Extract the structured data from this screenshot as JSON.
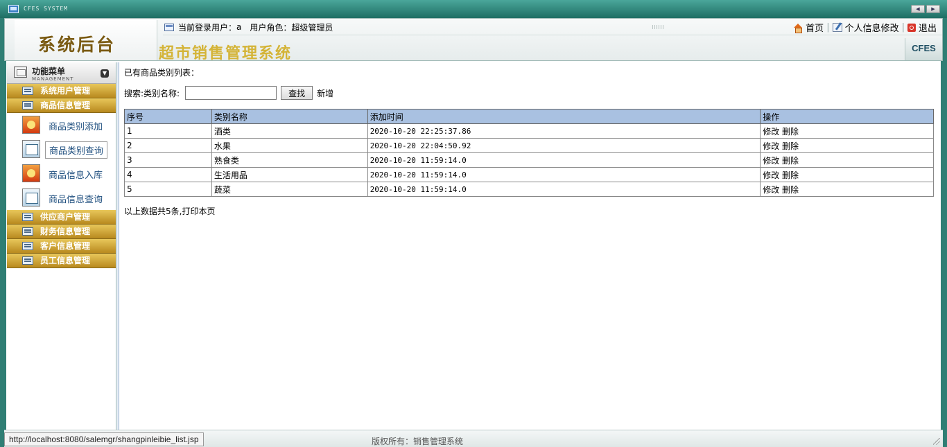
{
  "window": {
    "system_name": "CFES SYSTEM"
  },
  "header": {
    "back_title": "系统后台",
    "user_label": "当前登录用户：",
    "user_name": "a",
    "role_label": "用户角色：",
    "role_name": "超级管理员",
    "links": {
      "home": "首页",
      "profile": "个人信息修改",
      "logout": "退出"
    },
    "system_title": "超市销售管理系统",
    "brand": "CFES"
  },
  "sidebar": {
    "title": "功能菜单",
    "subtitle": "MANAGEMENT",
    "groups": [
      {
        "label": "系统用户管理"
      },
      {
        "label": "商品信息管理",
        "items": [
          {
            "label": "商品类别添加",
            "icon": "product-add-icon"
          },
          {
            "label": "商品类别查询",
            "icon": "product-query-icon",
            "active": true
          },
          {
            "label": "商品信息入库",
            "icon": "stock-in-icon"
          },
          {
            "label": "商品信息查询",
            "icon": "product-info-query-icon"
          }
        ]
      },
      {
        "label": "供应商户管理"
      },
      {
        "label": "财务信息管理"
      },
      {
        "label": "客户信息管理"
      },
      {
        "label": "员工信息管理"
      }
    ]
  },
  "main": {
    "heading": "已有商品类别列表：",
    "search": {
      "label": "搜索:类别名称:",
      "value": "",
      "button": "查找",
      "add_link": "新增"
    },
    "table": {
      "columns": [
        "序号",
        "类别名称",
        "添加时间",
        "操作"
      ],
      "rows": [
        {
          "id": "1",
          "name": "酒类",
          "time": "2020-10-20 22:25:37.86",
          "edit": "修改",
          "delete": "删除"
        },
        {
          "id": "2",
          "name": "水果",
          "time": "2020-10-20 22:04:50.92",
          "edit": "修改",
          "delete": "删除"
        },
        {
          "id": "3",
          "name": "熟食类",
          "time": "2020-10-20 11:59:14.0",
          "edit": "修改",
          "delete": "删除"
        },
        {
          "id": "4",
          "name": "生活用品",
          "time": "2020-10-20 11:59:14.0",
          "edit": "修改",
          "delete": "删除"
        },
        {
          "id": "5",
          "name": "蔬菜",
          "time": "2020-10-20 11:59:14.0",
          "edit": "修改",
          "delete": "删除"
        }
      ]
    },
    "summary_text": "以上数据共5条,",
    "print_link": "打印本页"
  },
  "footer": {
    "status_url": "http://localhost:8080/salemgr/shangpinleibie_list.jsp",
    "copyright": "版权所有：销售管理系统"
  },
  "colors": {
    "frame": "#2f7e74",
    "menu_gold": "#c99d2b",
    "table_header": "#a9c1e1"
  }
}
